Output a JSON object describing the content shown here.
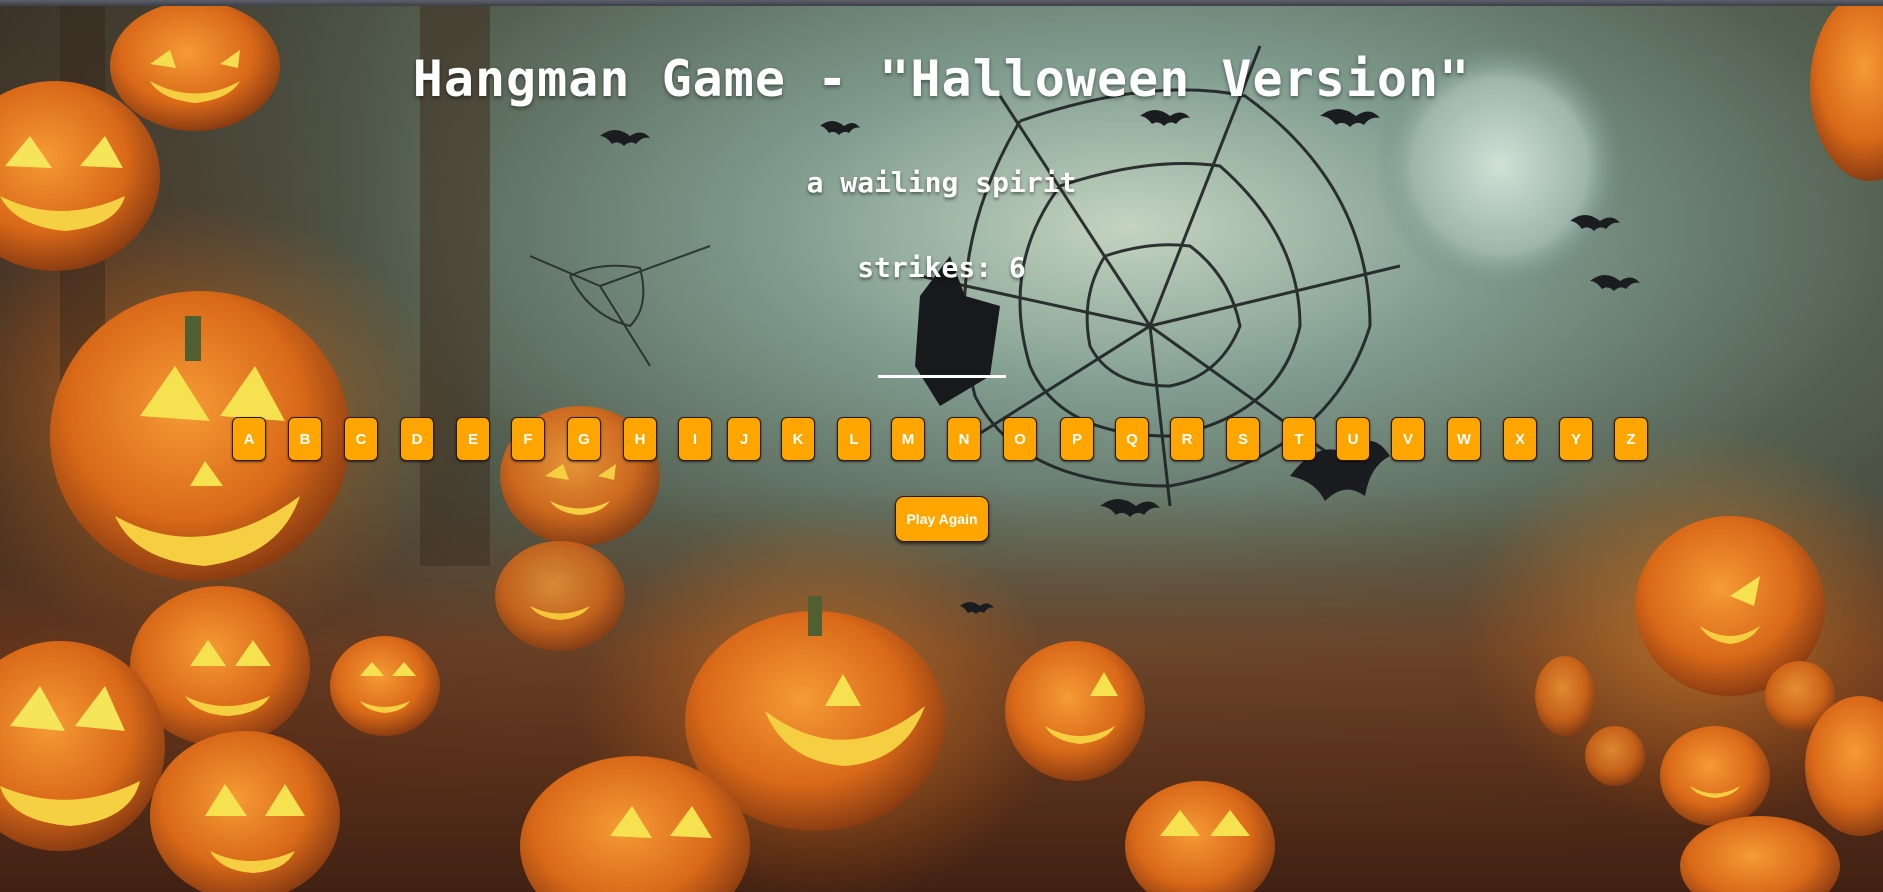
{
  "game": {
    "title": "Hangman Game - \"Halloween Version\"",
    "hint": "a wailing spirit",
    "strikes_label": "strikes: 6",
    "strikes": 6,
    "revealed_word_slots": 1,
    "letters": [
      "A",
      "B",
      "C",
      "D",
      "E",
      "F",
      "G",
      "H",
      "I",
      "J",
      "K",
      "L",
      "M",
      "N",
      "O",
      "P",
      "Q",
      "R",
      "S",
      "T",
      "U",
      "V",
      "W",
      "X",
      "Y",
      "Z"
    ],
    "play_again_label": "Play Again"
  },
  "theme": {
    "button_color": "#ffa500",
    "text_color": "#ffffff",
    "background": "halloween pumpkins and spider web"
  }
}
